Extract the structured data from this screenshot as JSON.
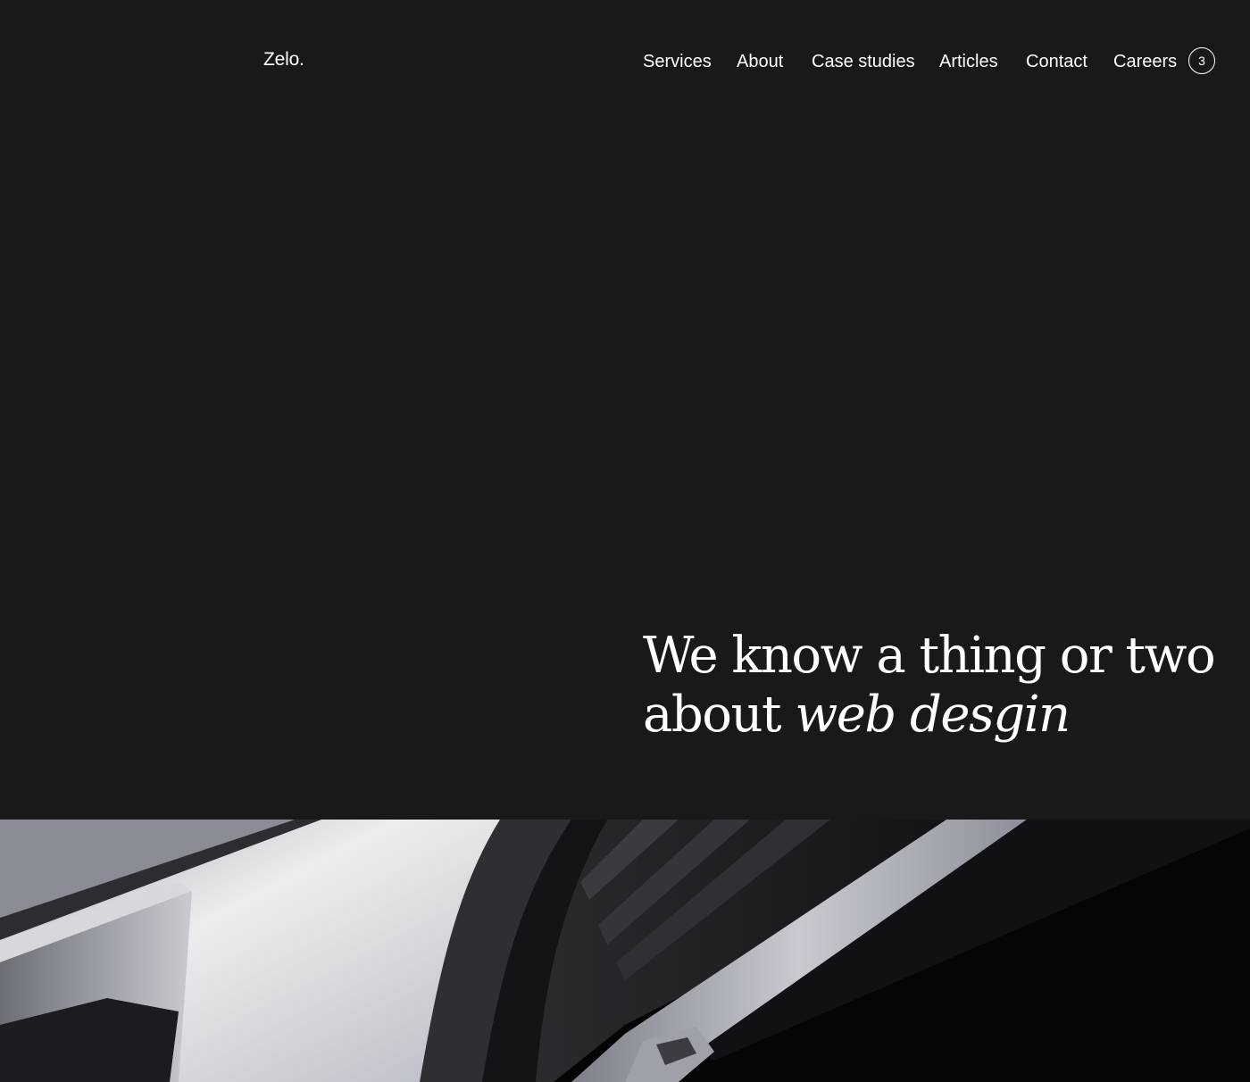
{
  "header": {
    "logo": "Zelo.",
    "nav": [
      {
        "label": "Services"
      },
      {
        "label": "About"
      },
      {
        "label": "Case studies"
      },
      {
        "label": "Articles"
      },
      {
        "label": "Contact"
      },
      {
        "label": "Careers"
      }
    ],
    "careers_count": "3"
  },
  "hero": {
    "heading_line1": "We know a thing or two",
    "heading_line2_prefix": "about ",
    "heading_line2_emphasis": "web desgin"
  },
  "colors": {
    "background": "#181a1a",
    "text": "#ffffff"
  },
  "icons": {
    "careers_badge": "circle-count-badge"
  }
}
